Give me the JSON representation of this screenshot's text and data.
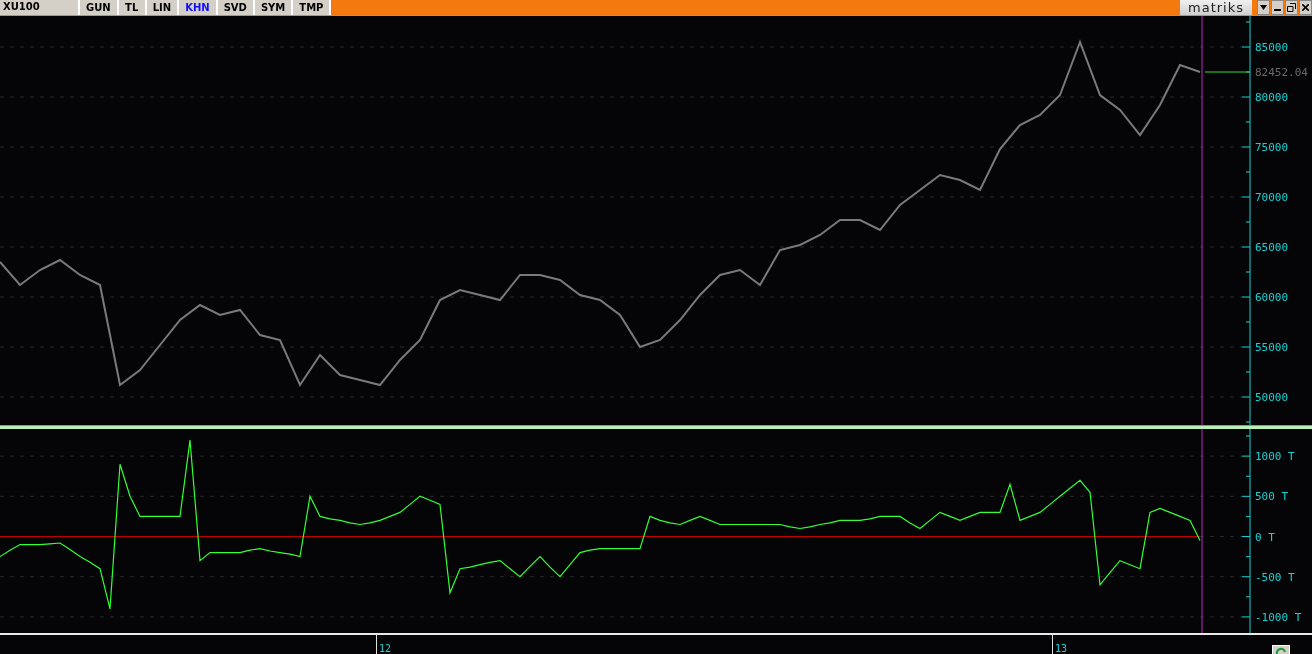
{
  "toolbar": {
    "symbol": "XU100",
    "tabs": [
      {
        "label": "GUN",
        "selected": false
      },
      {
        "label": "TL",
        "selected": false
      },
      {
        "label": "LIN",
        "selected": false
      },
      {
        "label": "KHN",
        "selected": true
      },
      {
        "label": "SVD",
        "selected": false
      },
      {
        "label": "SYM",
        "selected": false
      },
      {
        "label": "TMP",
        "selected": false
      }
    ],
    "logo": "matriks"
  },
  "charts": [
    {
      "last_price": "82452.04",
      "chart_data": {
        "type": "line",
        "categories": [
          null,
          null,
          null,
          null,
          null,
          null,
          null,
          null,
          null,
          null,
          null,
          null,
          null,
          null,
          null,
          null,
          null,
          null,
          null,
          null,
          null,
          null,
          null,
          null,
          null,
          null,
          null,
          null,
          null,
          null,
          null,
          null,
          null,
          null,
          null,
          null,
          null,
          null,
          null,
          null,
          null,
          null,
          null,
          null,
          null,
          null,
          null,
          null,
          null,
          null,
          null,
          null,
          null,
          null,
          null,
          null,
          null,
          null,
          null,
          null,
          null
        ],
        "series": [
          {
            "color": "#7a7a7a",
            "values": [
              63500,
              61200,
              62700,
              63700,
              62200,
              61200,
              51200,
              52700,
              55200,
              57700,
              59200,
              58200,
              58700,
              56200,
              55700,
              51200,
              54200,
              52200,
              51700,
              51200,
              53700,
              55700,
              59700,
              60700,
              60200,
              59700,
              62200,
              62200,
              61700,
              60200,
              59700,
              58200,
              55000,
              55700,
              57700,
              60200,
              62200,
              62700,
              61200,
              64700,
              65200,
              66200,
              67700,
              67700,
              66700,
              69200,
              70700,
              72200,
              71700,
              70700,
              74800,
              77200,
              78200,
              80200,
              85500,
              80200,
              78700,
              76200,
              79200,
              83200,
              82500
            ]
          }
        ],
        "grid": true,
        "ylim": [
          47200,
          88100
        ],
        "yticks": [
          50000,
          55000,
          60000,
          65000,
          70000,
          75000,
          80000,
          85000
        ]
      }
    },
    {
      "chart_data": {
        "type": "line",
        "categories": [
          null,
          null,
          null,
          null,
          null,
          null,
          null,
          null,
          null,
          null,
          null,
          null,
          null,
          null,
          null,
          null,
          null,
          null,
          null,
          null,
          null,
          null,
          null,
          null,
          null,
          null,
          null,
          null,
          null,
          null,
          null,
          null,
          null,
          null,
          null,
          null,
          null,
          null,
          null,
          null,
          null,
          null,
          null,
          null,
          null,
          null,
          null,
          null,
          null,
          null,
          null,
          null,
          null,
          null,
          null,
          null,
          null,
          null,
          null,
          null,
          null,
          null,
          null,
          null,
          null,
          null,
          null,
          null,
          null,
          null,
          null,
          null,
          null,
          null,
          null,
          null,
          null,
          null,
          null,
          null,
          null,
          null,
          null,
          null,
          null,
          null,
          null,
          null,
          null,
          null,
          null,
          null,
          null,
          null,
          null,
          null,
          null,
          null,
          null,
          null,
          null,
          null,
          null,
          null,
          null,
          null,
          null,
          null,
          null,
          null,
          null,
          null,
          null,
          null,
          null,
          null,
          null,
          null,
          null,
          null,
          null
        ],
        "series": [
          {
            "color": "#c00000",
            "values": [
              0,
              0,
              0,
              0,
              0,
              0,
              0,
              0,
              0,
              0,
              0,
              0,
              0,
              0,
              0,
              0,
              0,
              0,
              0,
              0,
              0,
              0,
              0,
              0,
              0,
              0,
              0,
              0,
              0,
              0,
              0,
              0,
              0,
              0,
              0,
              0,
              0,
              0,
              0,
              0,
              0,
              0,
              0,
              0,
              0,
              0,
              0,
              0,
              0,
              0,
              0,
              0,
              0,
              0,
              0,
              0,
              0,
              0,
              0,
              0,
              0,
              0,
              0,
              0,
              0,
              0,
              0,
              0,
              0,
              0,
              0,
              0,
              0,
              0,
              0,
              0,
              0,
              0,
              0,
              0,
              0,
              0,
              0,
              0,
              0,
              0,
              0,
              0,
              0,
              0,
              0,
              0,
              0,
              0,
              0,
              0,
              0,
              0,
              0,
              0,
              0,
              0,
              0,
              0,
              0,
              0,
              0,
              0,
              0,
              0,
              0,
              0,
              0,
              0,
              0,
              0,
              0,
              0,
              0,
              0,
              0
            ]
          },
          {
            "color": "#33ff33",
            "values": [
              -250,
              -170,
              -100,
              -100,
              -100,
              -90,
              -80,
              -160,
              -250,
              -320,
              -400,
              -900,
              900,
              500,
              250,
              250,
              250,
              250,
              250,
              1200,
              -300,
              -200,
              -200,
              -200,
              -200,
              -170,
              -150,
              -180,
              -200,
              -220,
              -250,
              500,
              250,
              220,
              200,
              170,
              150,
              170,
              200,
              250,
              300,
              400,
              500,
              450,
              400,
              -700,
              -400,
              -380,
              -350,
              -320,
              -300,
              -400,
              -500,
              -370,
              -250,
              -380,
              -500,
              -350,
              -200,
              -170,
              -150,
              -150,
              -150,
              -150,
              -150,
              250,
              200,
              170,
              150,
              200,
              250,
              200,
              150,
              150,
              150,
              150,
              150,
              150,
              150,
              120,
              100,
              120,
              150,
              170,
              200,
              200,
              200,
              220,
              250,
              250,
              250,
              170,
              100,
              200,
              300,
              250,
              200,
              250,
              300,
              300,
              300,
              650,
              200,
              250,
              300,
              400,
              500,
              600,
              700,
              550,
              -600,
              -450,
              -300,
              -350,
              -400,
              300,
              350,
              300,
              250,
              200,
              -50
            ]
          }
        ],
        "grid": true,
        "ylim": [
          -1200,
          1337.5
        ],
        "yticks": [
          {
            "value": 1000,
            "label": "1000 T"
          },
          {
            "value": 500,
            "label": "500 T"
          },
          {
            "value": 0,
            "label": "0 T"
          },
          {
            "value": -500,
            "label": "-500 T"
          },
          {
            "value": -1000,
            "label": "-1000 T"
          }
        ]
      }
    }
  ],
  "time_axis": {
    "labels": [
      "12",
      "13"
    ]
  }
}
